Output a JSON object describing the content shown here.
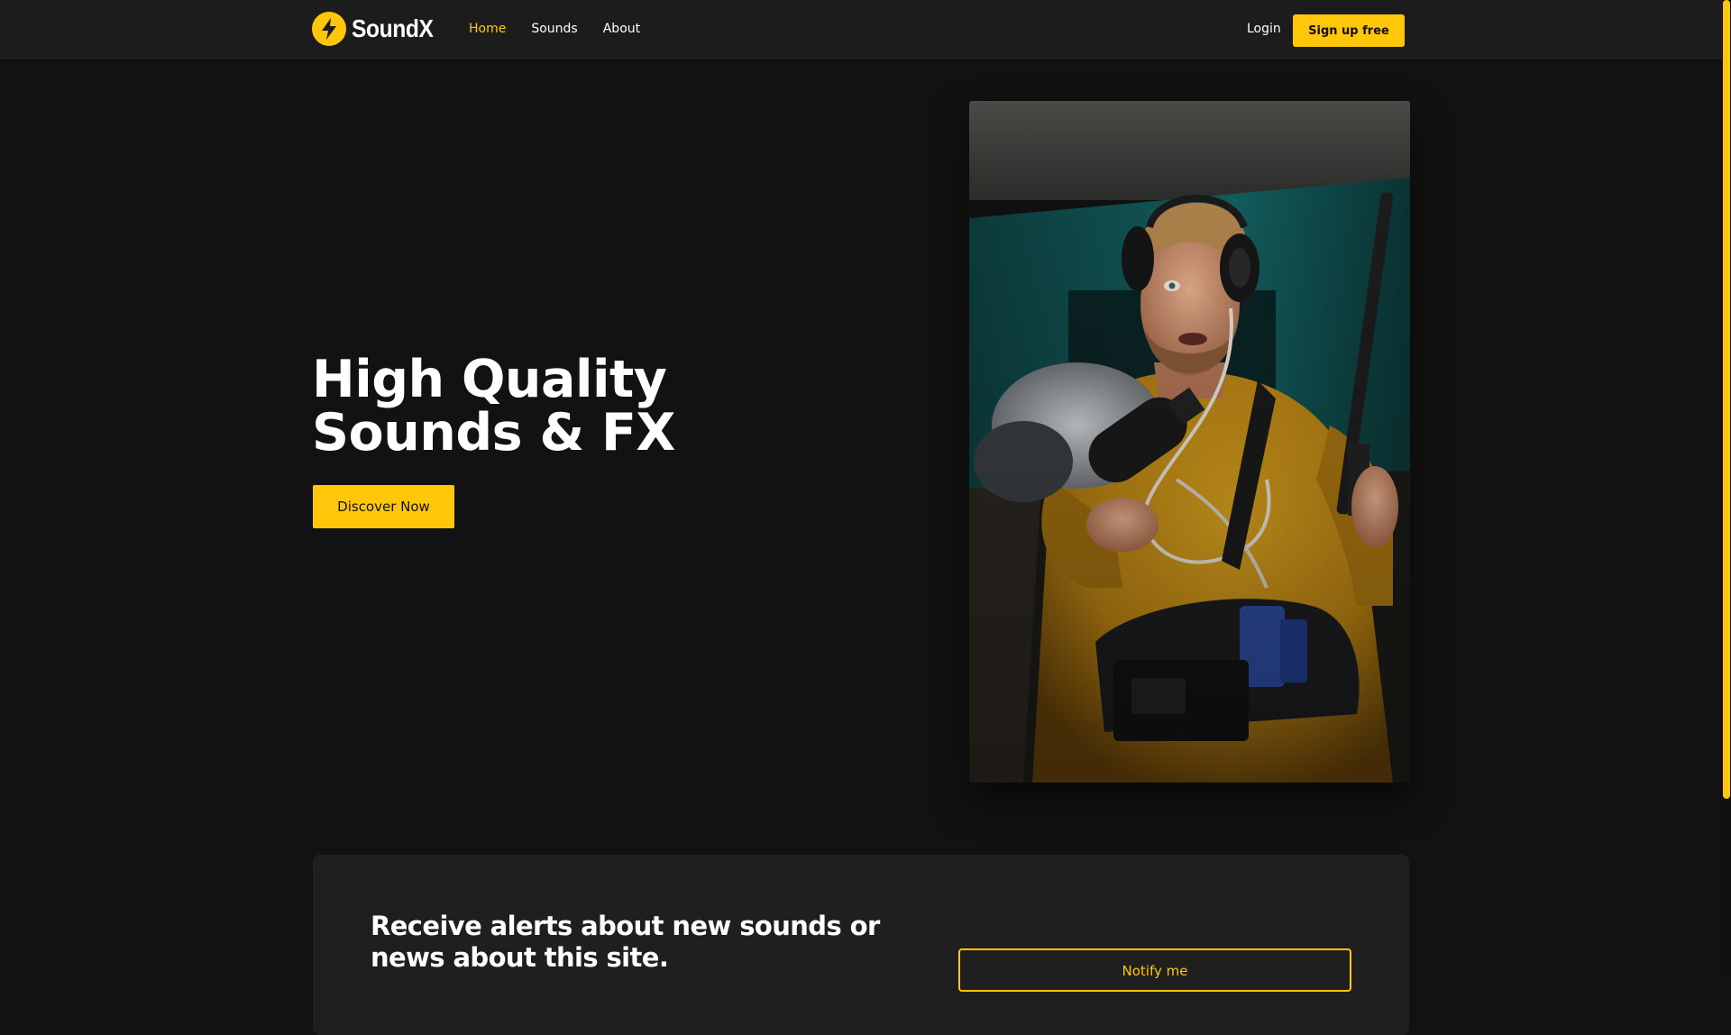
{
  "brand": {
    "name": "SoundX",
    "accent_color": "#ffc60a",
    "logo_icon": "lightning-bolt-icon"
  },
  "nav": {
    "links": [
      "Home",
      "Sounds",
      "About"
    ],
    "active": "Home",
    "login_label": "Login",
    "signup_label": "Sign up free"
  },
  "hero": {
    "title": "High Quality Sounds & FX",
    "cta_label": "Discover Now",
    "image": "photo-man-with-headphones-and-microphones"
  },
  "alerts": {
    "text": "Receive alerts about new sounds or news about this site.",
    "button_label": "Notify me"
  },
  "colors": {
    "background": "#121212",
    "navbar": "#1c1c1c",
    "card": "#1f1f1f"
  }
}
